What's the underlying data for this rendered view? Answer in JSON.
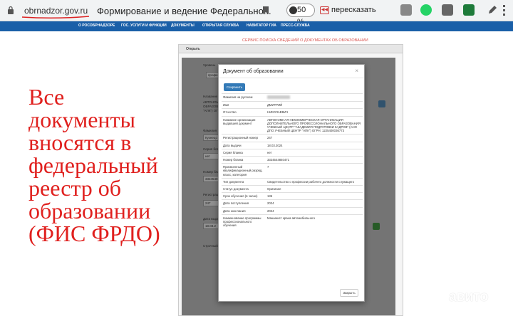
{
  "browser": {
    "url": "obrnadzor.gov.ru",
    "tab_title": "Формирование и ведение Федерально...",
    "zoom": "50 %",
    "retell_label": "пересказать"
  },
  "nav": {
    "items": [
      "О РОСОБРНАДЗОРЕ",
      "ГОС. УСЛУГИ И ФУНКЦИИ",
      "ДОКУМЕНТЫ",
      "ОТКРЫТАЯ СЛУЖБА",
      "НАВИГАТОР ГИА",
      "ПРЕСС-СЛУЖБА"
    ]
  },
  "service": {
    "title": "СЕРВИС ПОИСКА СВЕДЕНИЙ О ДОКУМЕНТАХ ОБ ОБРАЗОВАНИИ"
  },
  "panel": {
    "header": "Открыть"
  },
  "background_form": {
    "labels": [
      "Уровень",
      "Название",
      "Фамилия",
      "Серия бланка",
      "Номер бланка",
      "Регистрационный",
      "Дата выдачи",
      "Строчный"
    ],
    "values": [
      "профе",
      "Кузнецо",
      "нет",
      "3324540",
      "247",
      "18.03.2"
    ],
    "org_text": [
      "АВТОНОМ",
      "ОБРАЗОВ",
      "\"АПК\") ОГ"
    ]
  },
  "modal": {
    "title": "Документ об образовании",
    "close_symbol": "×",
    "save_label": "Сохранить",
    "close_label": "Закрыть",
    "rows": [
      {
        "key": "Фамилия на русском",
        "value": ""
      },
      {
        "key": "Имя",
        "value": "ДМИТРИЙ"
      },
      {
        "key": "Отчество",
        "value": "НИКОЛАЕВИЧ"
      },
      {
        "key": "Название организации выдавшей документ",
        "value": "АВТОНОМНАЯ НЕКОММЕРЧЕСКАЯ ОРГАНИЗАЦИЯ ДОПОЛНИТЕЛЬНОГО ПРОФЕССИОНАЛЬНОГО ОБРАЗОВАНИЯ УЧЕБНЫЙ ЦЕНТР \"АКАДЕМИЯ ПОДГОТОВКИ КАДРОВ\" (АНО ДПО УЧЕБНЫЙ ЦЕНТР \"АПК\") ОГРН: 1225400036773"
      },
      {
        "key": "Регистрационный номер",
        "value": "247"
      },
      {
        "key": "Дата выдачи",
        "value": "18.03.2024"
      },
      {
        "key": "Серия бланка",
        "value": "нет"
      },
      {
        "key": "Номер бланка",
        "value": "3324544840471"
      },
      {
        "key": "Присвоенный квалификационный разряд, класс, категория",
        "value": "7"
      },
      {
        "key": "Тип документа",
        "value": "Свидетельство о профессии рабочего должности служащего"
      },
      {
        "key": "Статус документа",
        "value": "Оригинал"
      },
      {
        "key": "Срок обучения (в часах)",
        "value": "136"
      },
      {
        "key": "Дата поступления",
        "value": "2024"
      },
      {
        "key": "Дата окончания",
        "value": "2024"
      },
      {
        "key": "Наименование программы профессионального обучения",
        "value": "Машинист крана автомобильного"
      }
    ]
  },
  "overlay_caption": {
    "lines": [
      "Все",
      "документы",
      "вносятся в",
      "федеральный",
      "реестр об",
      "образовании",
      "(ФИС ФРДО)"
    ]
  },
  "watermark": {
    "text": "авито"
  },
  "colors": {
    "nav": "#1a5fa8",
    "caption": "#e0201e",
    "save_button": "#337ab7"
  }
}
